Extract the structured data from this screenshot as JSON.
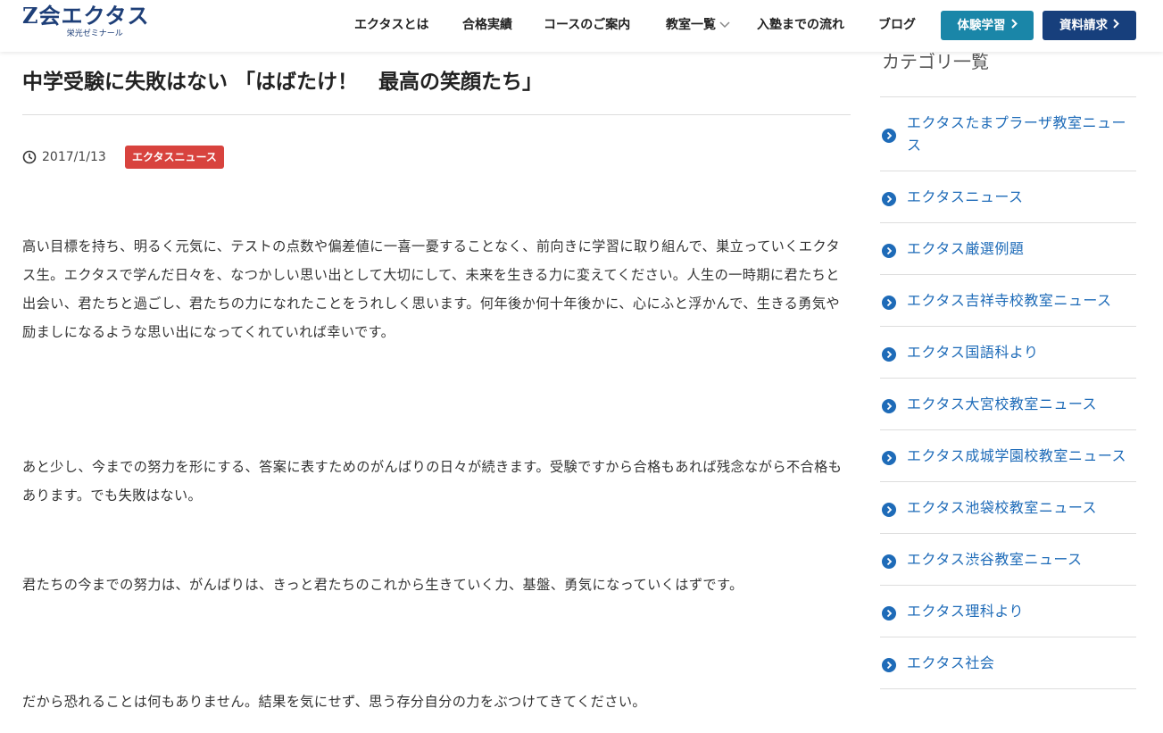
{
  "brand": {
    "logo_main": "Z会エクタス",
    "logo_sub": "栄光ゼミナール"
  },
  "nav": {
    "items": [
      {
        "label": "エクタスとは"
      },
      {
        "label": "合格実績"
      },
      {
        "label": "コースのご案内"
      },
      {
        "label": "教室一覧",
        "has_dropdown": true
      },
      {
        "label": "入塾までの流れ"
      },
      {
        "label": "ブログ"
      }
    ],
    "trial_button": "体験学習",
    "docs_button": "資料請求"
  },
  "article": {
    "title": "中学受験に失敗はない 「はばたけ！　最高の笑顔たち」",
    "date": "2017/1/13",
    "category": "エクタスニュース",
    "paragraphs": [
      "高い目標を持ち、明るく元気に、テストの点数や偏差値に一喜一憂することなく、前向きに学習に取り組んで、巣立っていくエクタス生。エクタスで学んだ日々を、なつかしい思い出として大切にして、未来を生きる力に変えてください。人生の一時期に君たちと出会い、君たちと過ごし、君たちの力になれたことをうれしく思います。何年後か何十年後かに、心にふと浮かんで、生きる勇気や励ましになるような思い出になってくれていれば幸いです。",
      "あと少し、今までの努力を形にする、答案に表すためのがんばりの日々が続きます。受験ですから合格もあれば残念ながら不合格もあります。でも失敗はない。",
      "君たちの今までの努力は、がんばりは、きっと君たちのこれから生きていく力、基盤、勇気になっていくはずです。",
      "だから恐れることは何もありません。結果を気にせず、思う存分自分の力をぶつけてきてください。"
    ]
  },
  "sidebar": {
    "heading": "カテゴリ一覧",
    "categories": [
      {
        "label": "エクタスたまプラーザ教室ニュース"
      },
      {
        "label": "エクタスニュース"
      },
      {
        "label": "エクタス厳選例題"
      },
      {
        "label": "エクタス吉祥寺校教室ニュース"
      },
      {
        "label": "エクタス国語科より"
      },
      {
        "label": "エクタス大宮校教室ニュース"
      },
      {
        "label": "エクタス成城学園校教室ニュース"
      },
      {
        "label": "エクタス池袋校教室ニュース"
      },
      {
        "label": "エクタス渋谷教室ニュース"
      },
      {
        "label": "エクタス理科より"
      },
      {
        "label": "エクタス社会"
      }
    ]
  },
  "colors": {
    "brand_navy": "#1e3f78",
    "trial_button": "#1a86a8",
    "docs_button": "#173f7c",
    "category_badge": "#d8433e",
    "sidebar_link": "#1e6bb8"
  },
  "icons": {
    "clock": "clock-icon",
    "sidebar_bullet": "circle-arrow-right-icon",
    "button_arrow": "chevron-right-icon",
    "dropdown": "chevron-down-icon"
  }
}
